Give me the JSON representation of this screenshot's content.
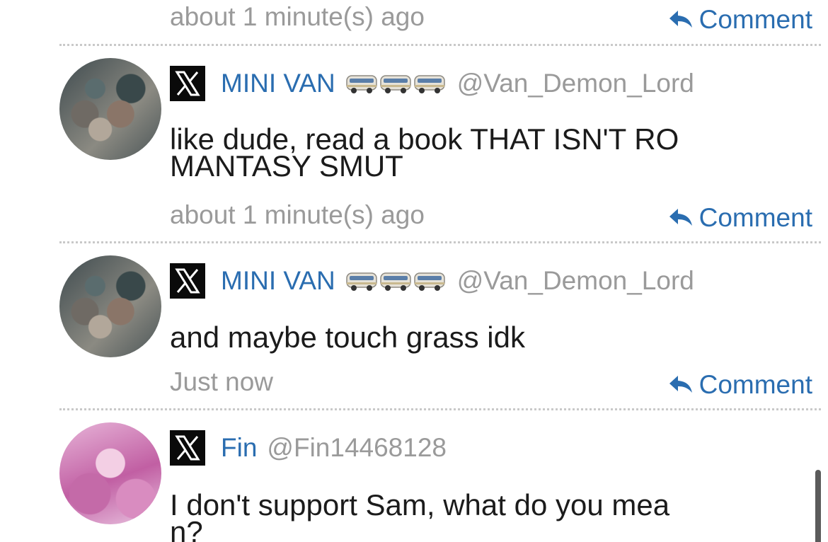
{
  "comment_label": "Comment",
  "posts": [
    {
      "time": "about 1 minute(s) ago"
    },
    {
      "author": "MINI VAN",
      "handle": "@Van_Demon_Lord",
      "emoji": [
        "minibus",
        "minibus",
        "minibus"
      ],
      "body_line1": "like dude, read a book THAT ISN'T RO",
      "body_line2": "MANTASY SMUT",
      "time": "about 1 minute(s) ago"
    },
    {
      "author": "MINI VAN",
      "handle": "@Van_Demon_Lord",
      "emoji": [
        "minibus",
        "minibus",
        "minibus"
      ],
      "body_line1": "and maybe touch grass idk",
      "time": "Just now"
    },
    {
      "author": "Fin",
      "handle": "@Fin14468128",
      "body_line1": "I don't support Sam, what do you mea",
      "body_line2": "n?"
    }
  ],
  "colors": {
    "link": "#2a6db0",
    "muted": "#9a9a9a",
    "text": "#1b1b1b",
    "divider": "#c9c9c9"
  }
}
